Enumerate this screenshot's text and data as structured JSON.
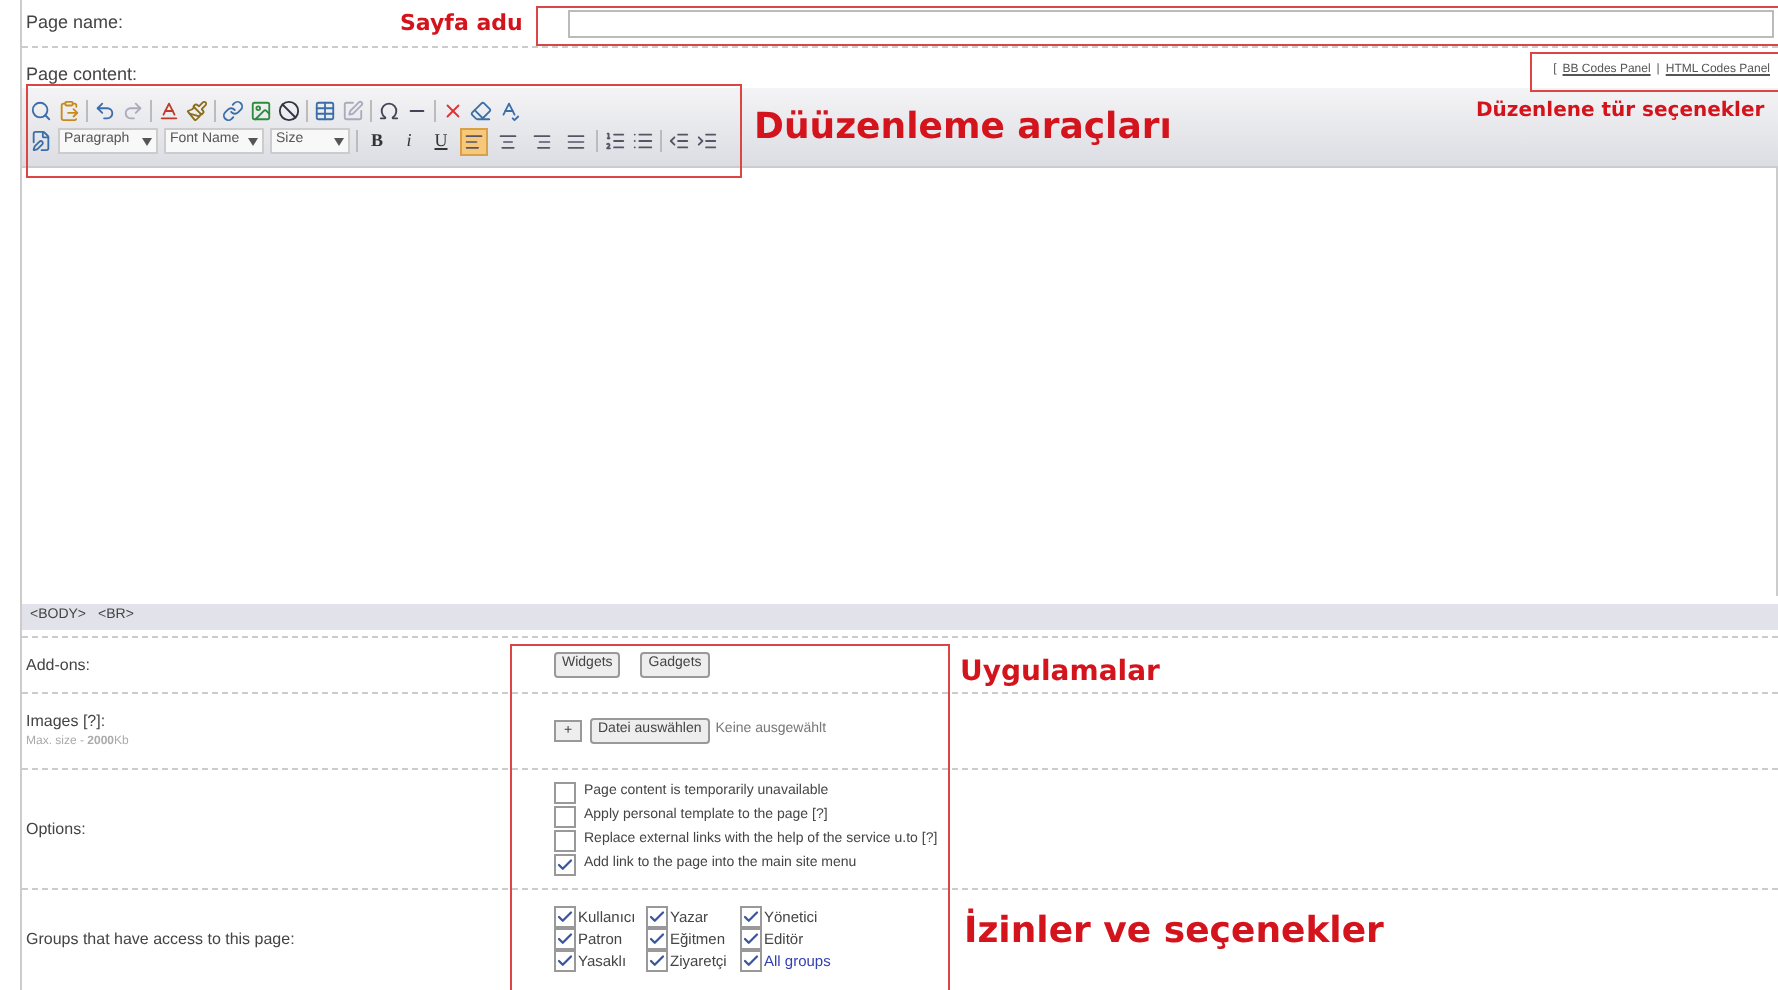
{
  "page_name": {
    "label": "Page name:",
    "annotation": "Sayfa adu"
  },
  "page_content": {
    "label": "Page content:",
    "panel_links": {
      "open": "[",
      "links": [
        "BB Codes Panel",
        "HTML Codes Panel"
      ],
      "separator": "|"
    },
    "panel_annotation": "Düzenlene tür seçenekler",
    "toolbar_annotation": "Düüzenleme araçları"
  },
  "toolbar": {
    "selects": [
      "Paragraph",
      "Font Name",
      "Size"
    ],
    "format_buttons": [
      "B",
      "i",
      "U"
    ],
    "align_buttons": [
      {
        "selected": true
      },
      {
        "selected": false
      },
      {
        "selected": false
      },
      {
        "selected": false
      }
    ]
  },
  "path_bar": [
    "<BODY>",
    "<BR>"
  ],
  "addons": {
    "label": "Add-ons:",
    "buttons": [
      "Widgets",
      "Gadgets"
    ],
    "annotation": "Uygulamalar"
  },
  "images": {
    "label": "Images [?]:",
    "hint": "Max. size - **2000**Kb",
    "add": "+",
    "choose": "Datei auswählen",
    "status": "Keine ausgewählt"
  },
  "options": {
    "label": "Options:",
    "items": [
      {
        "text": "Page content is temporarily unavailable",
        "checked": false
      },
      {
        "text": "Apply personal template to the page [?]",
        "checked": false
      },
      {
        "text": "Replace external links with the help of the service u.to [?]",
        "checked": false
      },
      {
        "text": "Add link to the page into the main site menu",
        "checked": true
      }
    ]
  },
  "groups": {
    "label": "Groups that have access to this page:",
    "annotation": "İzinler ve seçenekler",
    "items": [
      {
        "text": "Kullanıcı",
        "checked": true,
        "kind": "plain"
      },
      {
        "text": "Yazar",
        "checked": true,
        "kind": "plain"
      },
      {
        "text": "Yönetici",
        "checked": true,
        "kind": "plain"
      },
      {
        "text": "Patron",
        "checked": true,
        "kind": "plain"
      },
      {
        "text": "Eğitmen",
        "checked": true,
        "kind": "plain"
      },
      {
        "text": "Editör",
        "checked": true,
        "kind": "plain"
      },
      {
        "text": "Yasaklı",
        "checked": true,
        "kind": "plain"
      },
      {
        "text": "Ziyaretçi",
        "checked": true,
        "kind": "plain"
      },
      {
        "text": "All groups",
        "checked": true,
        "kind": "link"
      }
    ]
  }
}
